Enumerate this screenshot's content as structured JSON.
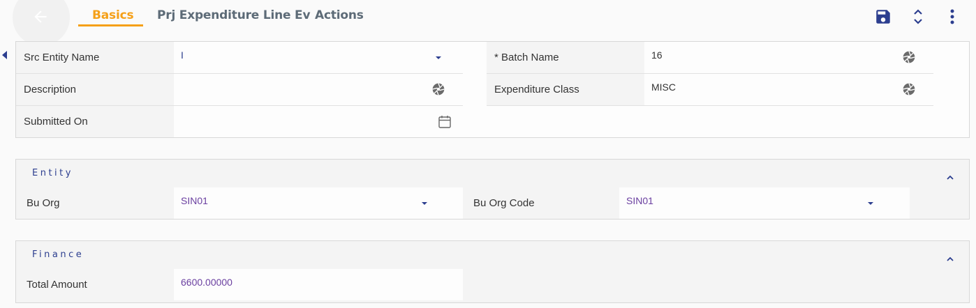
{
  "header": {
    "tabs": [
      {
        "label": "Basics",
        "active": true
      },
      {
        "label": "Prj Expenditure Line Ev",
        "active": false
      },
      {
        "label": "Actions",
        "active": false
      }
    ]
  },
  "form": {
    "src_entity_name": {
      "label": "Src Entity Name",
      "value": "I"
    },
    "description": {
      "label": "Description",
      "value": ""
    },
    "submitted_on": {
      "label": "Submitted On",
      "value": ""
    },
    "batch_name": {
      "label": "* Batch Name",
      "value": "16"
    },
    "expenditure_class": {
      "label": "Expenditure Class",
      "value": "MISC"
    }
  },
  "entity": {
    "title": "Entity",
    "bu_org": {
      "label": "Bu Org",
      "value": "SIN01"
    },
    "bu_org_code": {
      "label": "Bu Org Code",
      "value": "SIN01"
    }
  },
  "finance": {
    "title": "Finance",
    "total_amount": {
      "label": "Total Amount",
      "value": "6600.00000"
    }
  },
  "colors": {
    "accent": "#f5a018",
    "primary": "#2c3e8f",
    "value_purple": "#6a3fa0"
  },
  "icons": [
    "back-arrow-icon",
    "save-icon",
    "expand-collapse-icon",
    "more-vert-icon",
    "dropdown-caret-icon",
    "aperture-icon",
    "calendar-icon",
    "chevron-up-icon"
  ]
}
